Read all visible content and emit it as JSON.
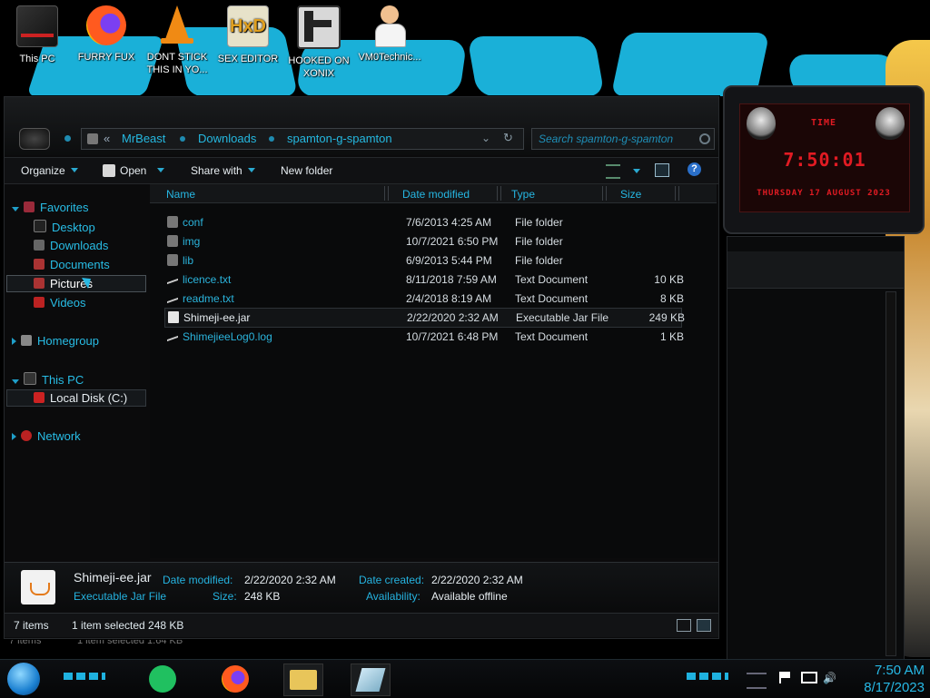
{
  "desktop": {
    "icons": [
      {
        "label": "This PC"
      },
      {
        "label": "FURRY FUX"
      },
      {
        "label": "DONT STICK\nTHIS IN YO..."
      },
      {
        "label": "SEX EDITOR"
      },
      {
        "label": "HOOKED ON\nXONIX"
      },
      {
        "label": "VM0Technic..."
      }
    ]
  },
  "explorer": {
    "breadcrumb": {
      "overflow": "«",
      "items": [
        "MrBeast",
        "Downloads",
        "spamton-g-spamton"
      ]
    },
    "search_placeholder": "Search spamton-g-spamton",
    "toolbar": {
      "organize": "Organize",
      "open": "Open",
      "share_with": "Share with",
      "new_folder": "New folder"
    },
    "nav": {
      "favorites": "Favorites",
      "desktop": "Desktop",
      "downloads": "Downloads",
      "documents": "Documents",
      "pictures": "Pictures",
      "videos": "Videos",
      "homegroup": "Homegroup",
      "this_pc": "This PC",
      "local_disk": "Local Disk (C:)",
      "network": "Network"
    },
    "columns": {
      "name": "Name",
      "date_modified": "Date modified",
      "type": "Type",
      "size": "Size"
    },
    "files": [
      {
        "name": "conf",
        "date": "7/6/2013 4:25 AM",
        "type": "File folder",
        "size": ""
      },
      {
        "name": "img",
        "date": "10/7/2021 6:50 PM",
        "type": "File folder",
        "size": ""
      },
      {
        "name": "lib",
        "date": "6/9/2013 5:44 PM",
        "type": "File folder",
        "size": ""
      },
      {
        "name": "licence.txt",
        "date": "8/11/2018 7:59 AM",
        "type": "Text Document",
        "size": "10 KB"
      },
      {
        "name": "readme.txt",
        "date": "2/4/2018 8:19 AM",
        "type": "Text Document",
        "size": "8 KB"
      },
      {
        "name": "Shimeji-ee.jar",
        "date": "2/22/2020 2:32 AM",
        "type": "Executable Jar File",
        "size": "249 KB"
      },
      {
        "name": "ShimejieeLog0.log",
        "date": "10/7/2021 6:48 PM",
        "type": "Text Document",
        "size": "1 KB"
      }
    ],
    "details": {
      "filename": "Shimeji-ee.jar",
      "filetype": "Executable Jar File",
      "date_modified_label": "Date modified:",
      "date_modified": "2/22/2020 2:32 AM",
      "size_label": "Size:",
      "size": "248 KB",
      "date_created_label": "Date created:",
      "date_created": "2/22/2020 2:32 AM",
      "availability_label": "Availability:",
      "availability": "Available offline"
    },
    "status": {
      "items": "7 items",
      "selected": "1 item selected  248 KB"
    },
    "ghost_status": {
      "items": "7 items",
      "selected": "1 item selected  1.64 KB"
    }
  },
  "widget": {
    "header": "TIME",
    "time": "7:50:01",
    "date": "THURSDAY 17 AUGUST 2023"
  },
  "taskbar": {
    "time": "7:50 AM",
    "date": "8/17/2023"
  },
  "colors": {
    "accent": "#27b9e6",
    "widget_red": "#e21b23",
    "wallpaper_blue": "#1ab0d8"
  }
}
